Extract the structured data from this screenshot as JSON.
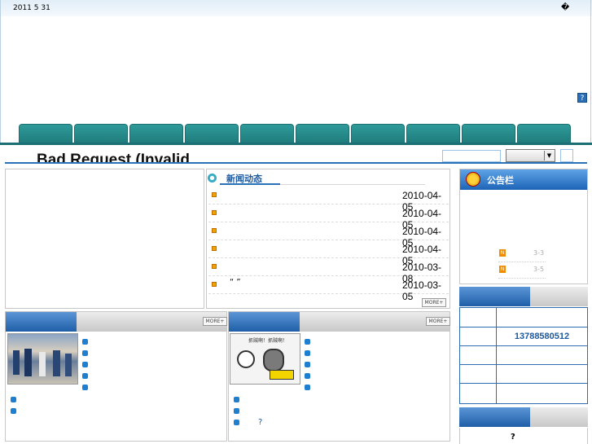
{
  "header": {
    "date_text": "2011 5 31",
    "corner_glyph": "�",
    "help_label": "?"
  },
  "banner": {
    "title": "Bad Request (Invalid"
  },
  "search": {
    "placeholder": "",
    "select_value": ""
  },
  "news": {
    "title": "新闻动态",
    "items": [
      {
        "text": "",
        "date": "2010-04-05"
      },
      {
        "text": "",
        "date": "2010-04-05"
      },
      {
        "text": "",
        "date": "2010-04-05"
      },
      {
        "text": "",
        "date": "2010-04-05"
      },
      {
        "text": "",
        "date": "2010-03-08"
      },
      {
        "text": "“ ”",
        "date": "2010-03-05"
      }
    ],
    "more_label": "MORE+"
  },
  "notice": {
    "title": "公告栏",
    "items": [
      {
        "badge": "N",
        "text": "3-3"
      },
      {
        "badge": "N",
        "text": "3-5"
      }
    ]
  },
  "contact": {
    "phone": "13788580512"
  },
  "panel3": {
    "more_label": "MORE+"
  },
  "panel4": {
    "more_label": "MORE+",
    "last_item": "?"
  },
  "bottom_right": {
    "text": "?"
  },
  "images": {
    "photo_left": "police-crowd-photo",
    "photo_right": "cartoon-thief-illustration",
    "cartoon_caption": "抓贼啊！抓贼啊！"
  },
  "colors": {
    "nav_tab": "#2f9a9a",
    "accent_blue": "#2a72b8",
    "header_blue": "#1f5fa8",
    "date_ink": "#000000"
  }
}
